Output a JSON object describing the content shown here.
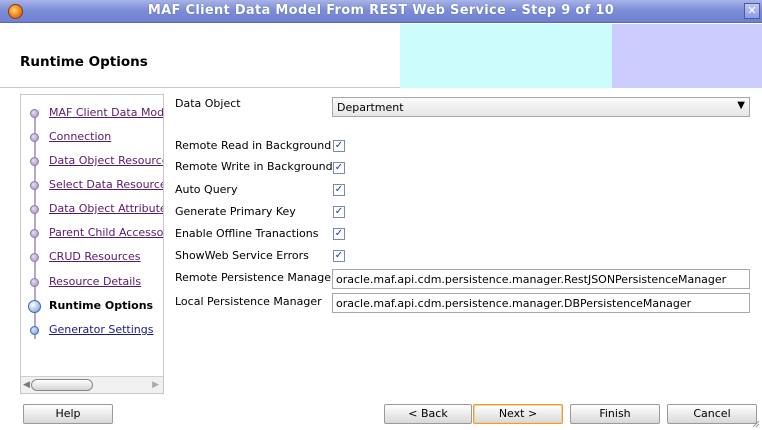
{
  "window": {
    "title": "MAF Client Data Model From REST Web Service - Step 9 of 10",
    "close_glyph": "✕"
  },
  "header": {
    "heading": "Runtime Options",
    "banner_colors": [
      "#ccfcfc",
      "#ccccff"
    ]
  },
  "nav": {
    "items": [
      {
        "label": "MAF Client Data Mode",
        "state": "visited"
      },
      {
        "label": "Connection",
        "state": "visited"
      },
      {
        "label": "Data Object Resource",
        "state": "visited"
      },
      {
        "label": "Select Data Resources",
        "state": "visited"
      },
      {
        "label": "Data Object Attributes",
        "state": "visited"
      },
      {
        "label": "Parent Child Accessor",
        "state": "visited"
      },
      {
        "label": "CRUD Resources",
        "state": "visited"
      },
      {
        "label": "Resource Details",
        "state": "visited"
      },
      {
        "label": "Runtime Options",
        "state": "current"
      },
      {
        "label": "Generator Settings",
        "state": "future"
      }
    ]
  },
  "form": {
    "data_object_label": "Data Object",
    "data_object_value": "Department",
    "checkboxes": [
      {
        "label": "Remote Read in Background",
        "checked": true
      },
      {
        "label": "Remote Write in Background",
        "checked": true
      },
      {
        "label": "Auto Query",
        "checked": true
      },
      {
        "label": "Generate Primary Key",
        "checked": true
      },
      {
        "label": "Enable Offline Tranactions",
        "checked": true
      },
      {
        "label": "ShowWeb Service Errors",
        "checked": true
      }
    ],
    "remote_persistence_label": "Remote Persistence Manager",
    "remote_persistence_value": "oracle.maf.api.cdm.persistence.manager.RestJSONPersistenceManager",
    "local_persistence_label": "Local Persistence Manager",
    "local_persistence_value": "oracle.maf.api.cdm.persistence.manager.DBPersistenceManager"
  },
  "buttons": {
    "help": "Help",
    "back": "< Back",
    "next": "Next >",
    "finish": "Finish",
    "cancel": "Cancel"
  }
}
